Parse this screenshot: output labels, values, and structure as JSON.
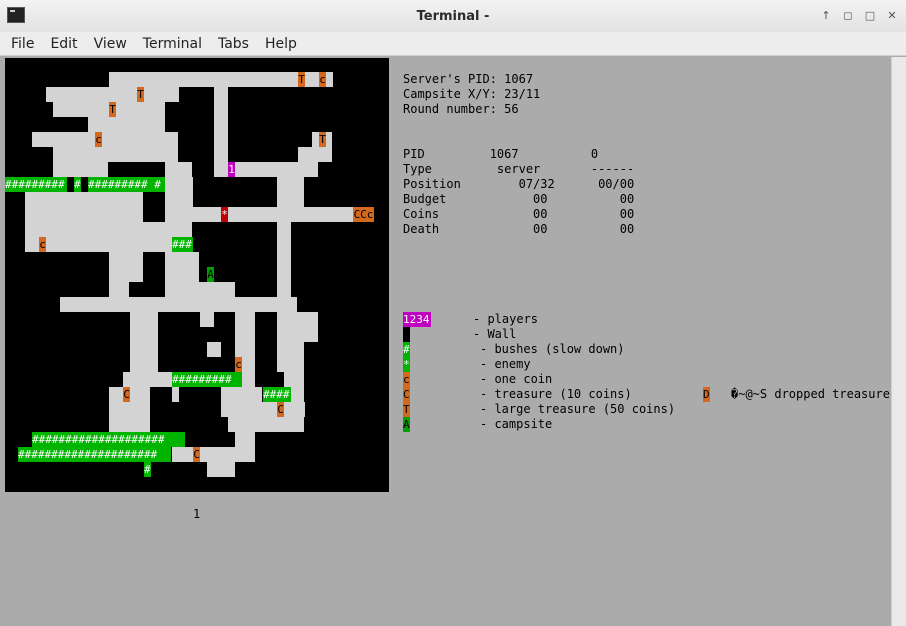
{
  "window": {
    "title": "Terminal -",
    "buttons": [
      "↑",
      "◻",
      "□",
      "✕"
    ]
  },
  "menu": [
    "File",
    "Edit",
    "View",
    "Terminal",
    "Tabs",
    "Help"
  ],
  "colors": {
    "wall": "#000000",
    "floor": "#d3d3d3",
    "bush": "#00b400",
    "coin": "#d2691e",
    "player": "#c000c0",
    "enemy": "#c00000",
    "campsite": "#00a000"
  },
  "map_glyphs": {
    "bushes_row1": "######### # ##########",
    "bushes_row2": "###",
    "bushes_row3": "#########",
    "bushes_row4": "####",
    "bushes_row5": "####################",
    "bushes_row6": "#####################",
    "bush_single": "#",
    "treasure": "T",
    "coin": "c",
    "coin_big": "C",
    "player": "1",
    "enemy": "*",
    "campsite": "A",
    "ccc": "CCc"
  },
  "below_map": "1",
  "server": {
    "pid_line": "Server's PID: 1067",
    "campsite_line": "Campsite X/Y: 23/11",
    "round_line": "Round number: 56"
  },
  "stats": [
    "PID         1067          0",
    "Type         server       ------",
    "Position        07/32      00/00",
    "Budget            00          00",
    "Coins             00          00",
    "Death             00          00"
  ],
  "legend": {
    "players_swatch": "1234",
    "players": "- players",
    "wall": "- Wall",
    "bushes_swatch": "#",
    "bushes": "- bushes (slow down)",
    "enemy_swatch": "*",
    "enemy": "- enemy",
    "coin_swatch": "c",
    "coin": "- one coin",
    "treasure_swatch": "C",
    "treasure": "- treasure (10 coins)",
    "dropped_swatch": "D",
    "dropped": "�~@~S dropped treasure",
    "large_swatch": "T",
    "large": "- large treasure (50 coins)",
    "campsite_swatch": "A",
    "campsite": "- campsite"
  }
}
